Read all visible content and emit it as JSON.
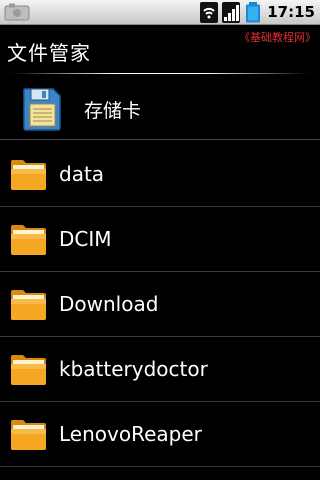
{
  "status_bar": {
    "time": "17:15",
    "icons": [
      "notification-icon",
      "wifi-icon",
      "signal-icon",
      "battery-icon"
    ]
  },
  "title_bar": {
    "title": "文件管家",
    "watermark": "《基础教程网》"
  },
  "storage": {
    "label": "存储卡",
    "icon": "sd-card-icon"
  },
  "folders": [
    {
      "name": "data"
    },
    {
      "name": "DCIM"
    },
    {
      "name": "Download"
    },
    {
      "name": "kbatterydoctor"
    },
    {
      "name": "LenovoReaper"
    }
  ],
  "colors": {
    "background": "#000000",
    "status_bar": "#dcdcdc",
    "folder_orange": "#f0a020",
    "watermark_red": "#e03030"
  }
}
